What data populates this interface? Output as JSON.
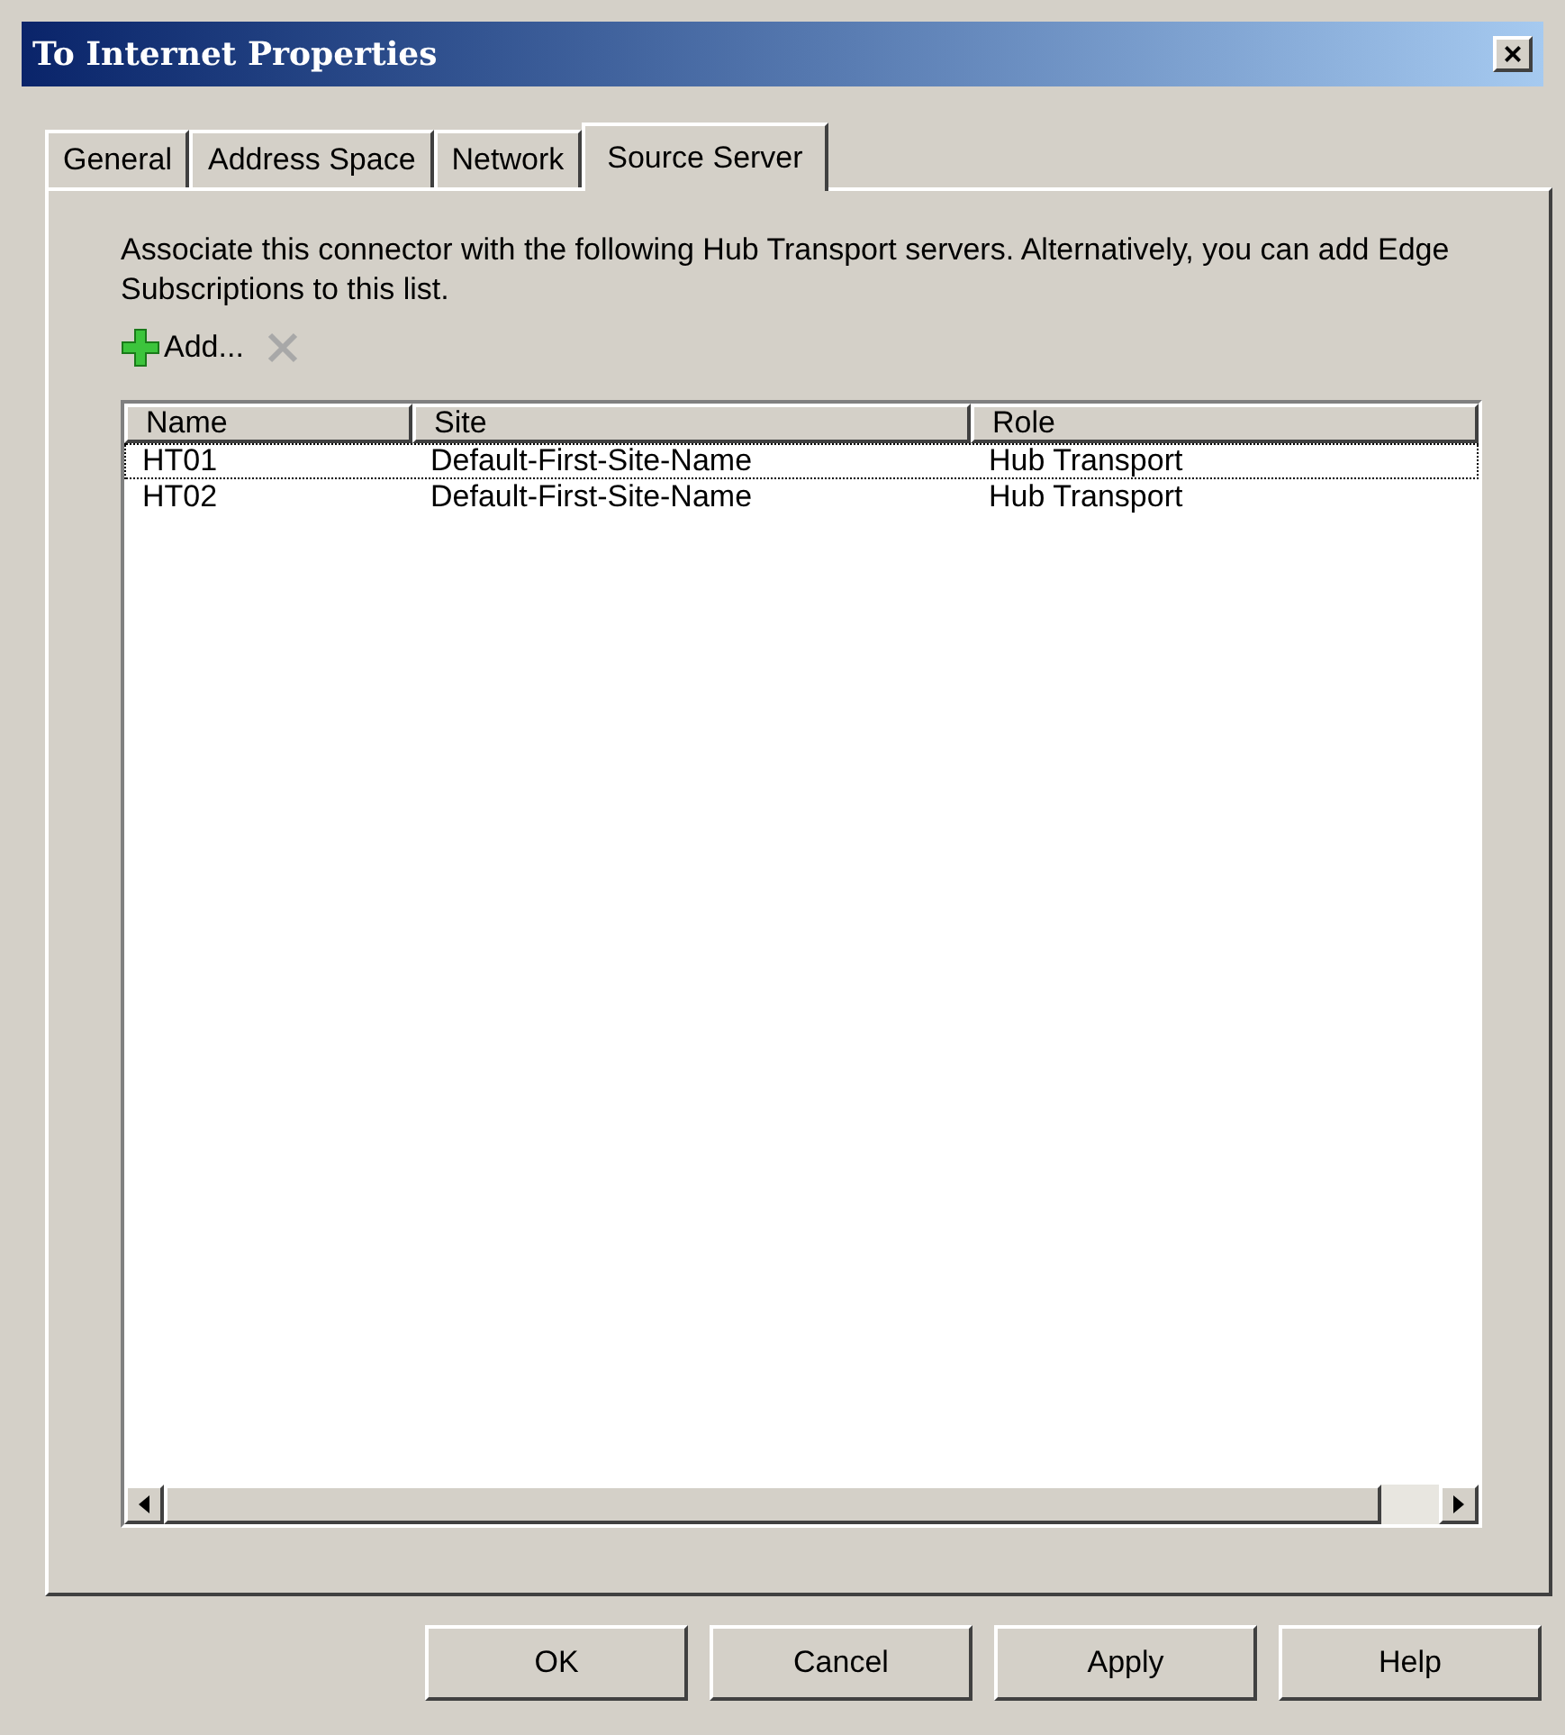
{
  "window": {
    "title": "To Internet Properties",
    "close": "×"
  },
  "tabs": [
    {
      "label": "General",
      "selected": false
    },
    {
      "label": "Address Space",
      "selected": false
    },
    {
      "label": "Network",
      "selected": false
    },
    {
      "label": "Source Server",
      "selected": true
    }
  ],
  "description": "Associate this connector with the following Hub Transport servers. Alternatively, you can add Edge Subscriptions to this list.",
  "toolbar": {
    "add": {
      "label": "Add...",
      "disabled": false
    },
    "remove": {
      "disabled": true
    }
  },
  "table": {
    "columns": [
      "Name",
      "Site",
      "Role"
    ],
    "rows": [
      {
        "cells": [
          "HT01",
          "Default-First-Site-Name",
          "Hub Transport"
        ],
        "focused": true
      },
      {
        "cells": [
          "HT02",
          "Default-First-Site-Name",
          "Hub Transport"
        ],
        "focused": false
      }
    ]
  },
  "buttons": [
    "OK",
    "Cancel",
    "Apply",
    "Help"
  ]
}
